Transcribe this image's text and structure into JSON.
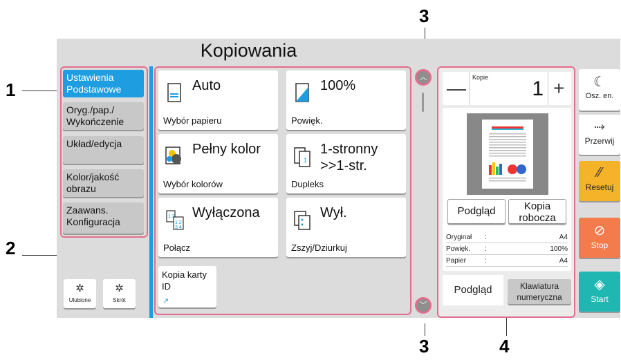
{
  "callouts": [
    "1",
    "2",
    "3",
    "3",
    "4"
  ],
  "screen": {
    "title": "Kopiowania",
    "tabs": [
      {
        "label": "Ustawienia Podstawowe",
        "active": true
      },
      {
        "label": "Oryg./pap./ Wykończenie"
      },
      {
        "label": "Układ/edycja"
      },
      {
        "label": "Kolor/jakość obrazu"
      },
      {
        "label": "Zaawans. Konfiguracja"
      }
    ],
    "small_buttons": [
      {
        "label": "Ulubione",
        "icon": "gear-icon"
      },
      {
        "label": "Skrót",
        "icon": "gear-icon"
      }
    ],
    "functions": [
      {
        "value": "Auto",
        "name": "Wybór papieru",
        "icon": "paper-icon"
      },
      {
        "value": "100%",
        "name": "Powięk.",
        "icon": "zoom-icon"
      },
      {
        "value": "Pełny kolor",
        "name": "Wybór kolorów",
        "icon": "color-icon"
      },
      {
        "value": "1-stronny >>1-str.",
        "name": "Dupleks",
        "icon": "duplex-icon"
      },
      {
        "value": "Wyłączona",
        "name": "Połącz",
        "icon": "combine-icon"
      },
      {
        "value": "Wył.",
        "name": "Zszyj/Dziurkuj",
        "icon": "staple-icon"
      }
    ],
    "id_card": {
      "label": "Kopia karty ID",
      "icon": "shortcut-arrow-icon"
    },
    "copies": {
      "label": "Kopie",
      "value": "1",
      "minus": "—",
      "plus": "+"
    },
    "preview_buttons": {
      "preview": "Podgląd",
      "draft": "Kopia robocza"
    },
    "info": [
      {
        "key": "Oryginał",
        "value": "A4"
      },
      {
        "key": "Powięk.",
        "value": "100%"
      },
      {
        "key": "Papier",
        "value": "A4"
      }
    ],
    "bottom_tabs": {
      "preview": "Podgląd",
      "keypad": "Klawiatura numeryczna"
    },
    "side_buttons": [
      {
        "label": "Osz. en.",
        "icon": "moon-icon",
        "color": "#ffffff"
      },
      {
        "label": "Przerwij",
        "icon": "interrupt-icon",
        "color": "#ffffff"
      },
      {
        "label": "Resetuj",
        "icon": "reset-icon",
        "color": "#f5b32a"
      },
      {
        "label": "Stop",
        "icon": "stop-icon",
        "color": "#f37b4c"
      },
      {
        "label": "Start",
        "icon": "start-icon",
        "color": "#20b6b2"
      }
    ]
  },
  "colors": {
    "accent": "#1e9de0",
    "highlight": "#e36d8e",
    "reset": "#f5b32a",
    "stop": "#f37b4c",
    "start": "#20b6b2"
  }
}
